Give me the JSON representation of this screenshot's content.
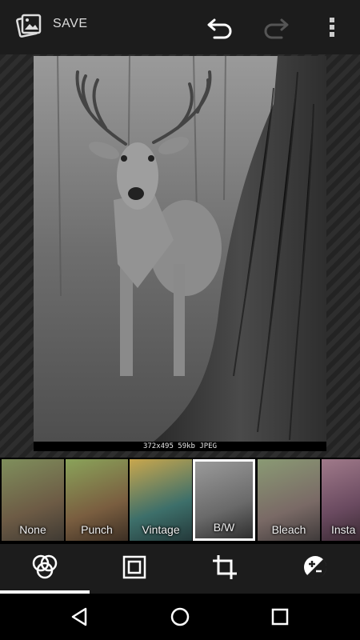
{
  "toolbar": {
    "save_label": "SAVE",
    "save_icon": "save-photo-icon",
    "undo_icon": "undo-icon",
    "redo_icon": "redo-icon",
    "overflow_icon": "more-vert-icon"
  },
  "photo": {
    "info_text": "372x495 59kb JPEG"
  },
  "filters": [
    {
      "label": "None",
      "selected": false
    },
    {
      "label": "Punch",
      "selected": false
    },
    {
      "label": "Vintage",
      "selected": false
    },
    {
      "label": "B/W",
      "selected": true
    },
    {
      "label": "Bleach",
      "selected": false
    },
    {
      "label": "Insta",
      "selected": false
    }
  ],
  "tools": [
    {
      "name": "filters-tab",
      "icon": "filters-icon",
      "active": true
    },
    {
      "name": "frames-tab",
      "icon": "frame-icon",
      "active": false
    },
    {
      "name": "crop-tab",
      "icon": "crop-icon",
      "active": false
    },
    {
      "name": "exposure-tab",
      "icon": "exposure-icon",
      "active": false
    }
  ],
  "navbar": {
    "back_icon": "back-triangle-icon",
    "home_icon": "home-circle-icon",
    "recents_icon": "recents-square-icon"
  }
}
